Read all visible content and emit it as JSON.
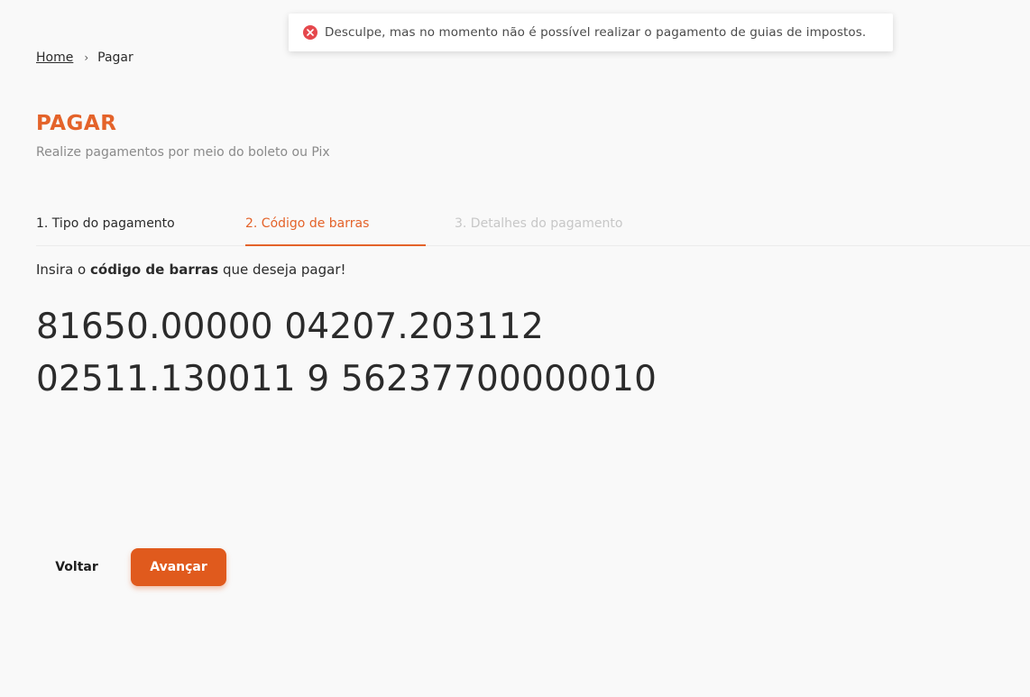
{
  "toast": {
    "icon": "error-circle-icon",
    "icon_color": "#e5484d",
    "message": "Desculpe, mas no momento não é possível realizar o pagamento de guias de impostos."
  },
  "breadcrumb": {
    "home": "Home",
    "separator": "›",
    "current": "Pagar"
  },
  "header": {
    "title": "PAGAR",
    "subtitle": "Realize pagamentos por meio do boleto ou Pix",
    "accent_color": "#e4632a"
  },
  "steps": [
    {
      "label": "1. Tipo do pagamento",
      "state": "completed"
    },
    {
      "label": "2. Código de barras",
      "state": "active"
    },
    {
      "label": "3. Detalhes do pagamento",
      "state": "disabled"
    }
  ],
  "instruction": {
    "prefix": "Insira o ",
    "bold": "código de barras",
    "suffix": " que deseja pagar!"
  },
  "barcode": {
    "value": "81650.00000 04207.203112 02511.130011 9 56237700000010"
  },
  "actions": {
    "back_label": "Voltar",
    "next_label": "Avançar",
    "next_color": "#e05a1d"
  }
}
